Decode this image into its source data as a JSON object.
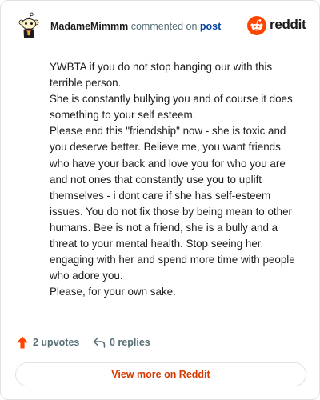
{
  "header": {
    "username": "MadameMimmm",
    "verb": "commented on",
    "post_link": "post",
    "avatar_icon": "snoo-avatar-icon",
    "brand_icon": "reddit-logo-icon",
    "brand_word": "reddit"
  },
  "comment": {
    "paragraphs": [
      "YWBTA if you do not stop hanging our with this terrible person.",
      "She is constantly bullying you and of course it does something to your self esteem.",
      "Please end this \"friendship\" now - she is toxic and you deserve better. Believe me, you want friends who have your back and love you for who you are and not ones that constantly use you to uplift themselves - i dont care if she has self-esteem issues. You do not fix those by being mean to other humans. Bee is not a friend, she is a bully and a threat to your mental health. Stop seeing her, engaging with her and spend more time with people who adore you.",
      "Please, for your own sake."
    ]
  },
  "actions": {
    "upvotes_label": "2 upvotes",
    "upvote_icon": "upvote-arrow-icon",
    "replies_label": "0 replies",
    "reply_icon": "reply-arrow-icon"
  },
  "footer": {
    "view_more_label": "View more on Reddit"
  },
  "colors": {
    "brand_orange": "#ff4500",
    "link_blue": "#0a449b",
    "muted_text": "#576f76",
    "view_more_text": "#d93900",
    "border": "#dfe2e6"
  }
}
